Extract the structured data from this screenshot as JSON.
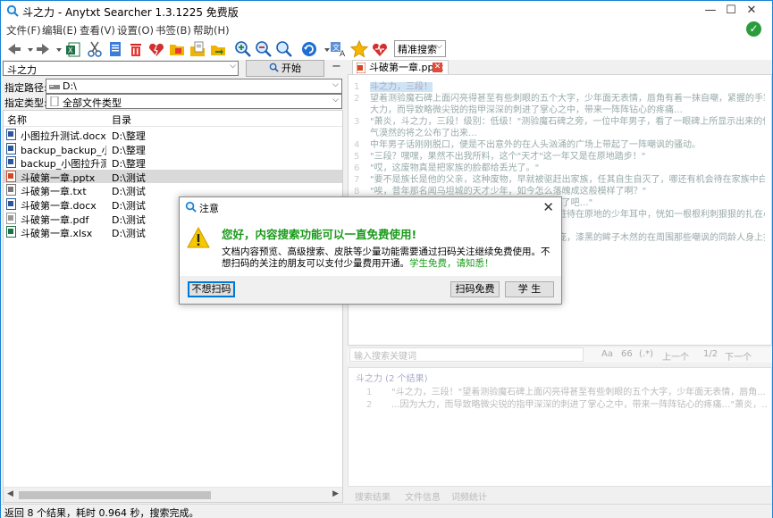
{
  "window": {
    "title": "斗之力 - Anytxt Searcher 1.3.1225 免费版",
    "controls": {
      "minimize": "—",
      "maximize": "☐",
      "close": "✕"
    }
  },
  "menu": {
    "items": [
      "文件(F)",
      "编辑(E)",
      "查看(V)",
      "设置(O)",
      "书签(B)",
      "帮助(H)"
    ]
  },
  "toolbar": {
    "search_mode": "精准搜索",
    "icons": [
      "back-arrow-icon",
      "back-dropdown-icon",
      "forward-arrow-icon",
      "forward-dropdown-icon",
      "excel-export-icon",
      "scissors-icon",
      "copy-doc-icon",
      "trash-icon",
      "broken-heart-icon",
      "open-folder-icon",
      "doc-folder-icon",
      "folder-arrow-icon",
      "zoom-in-icon",
      "zoom-out-icon",
      "search-icon",
      "refresh-icon",
      "translate-icon",
      "star-icon",
      "heart-icon"
    ]
  },
  "search": {
    "query": "斗之力",
    "start_label": "开始",
    "minus_label": "−"
  },
  "filters": {
    "path_label": "指定路径:",
    "path_value": "D:\\",
    "type_label": "指定类型:",
    "type_value": "全部文件类型"
  },
  "filelist": {
    "col_name": "名称",
    "col_dir": "目录",
    "rows": [
      {
        "name": "小图拉升测试.docx",
        "dir": "D:\\整理",
        "type": "word"
      },
      {
        "name": "backup_backup_小...",
        "dir": "D:\\整理",
        "type": "word"
      },
      {
        "name": "backup_小图拉升测...",
        "dir": "D:\\整理",
        "type": "word"
      },
      {
        "name": "斗破第一章.pptx",
        "dir": "D:\\测试",
        "type": "ppt",
        "selected": true
      },
      {
        "name": "斗破第一章.txt",
        "dir": "D:\\测试",
        "type": "txt"
      },
      {
        "name": "斗破第一章.docx",
        "dir": "D:\\测试",
        "type": "word"
      },
      {
        "name": "斗破第一章.pdf",
        "dir": "D:\\测试",
        "type": "pdf"
      },
      {
        "name": "斗破第一章.xlsx",
        "dir": "D:\\测试",
        "type": "excel"
      }
    ]
  },
  "preview": {
    "tab_label": "斗破第一章.pptx",
    "lines": [
      {
        "n": "1",
        "t": "斗之力，三段！"
      },
      {
        "n": "2",
        "t": "望着测验魔石碑上面闪亮得甚至有些刺眼的五个大字，少年面无表情，唇角有着一抹自嘲，紧握的手掌，因为"
      },
      {
        "n": "",
        "t": "大力，而导致略微尖锐的指甲深深的刺进了掌心之中，带来一阵阵钻心的疼痛…"
      },
      {
        "n": "3",
        "t": "\"萧炎，斗之力，三段！级别：低级！\"测验魔石碑之旁，一位中年男子，看了一眼碑上所显示出来的信息，语"
      },
      {
        "n": "",
        "t": "气漠然的将之公布了出来…"
      },
      {
        "n": "4",
        "t": "中年男子话刚刚脱口，便是不出意外的在人头汹涌的广场上带起了一阵嘲讽的骚动。"
      },
      {
        "n": "5",
        "t": "\"三段？嘿嘿，果然不出我所料，这个\"天才\"这一年又是在原地踏步！\""
      },
      {
        "n": "6",
        "t": "\"哎，这废物真是把家族的脸都给丢光了。\""
      },
      {
        "n": "7",
        "t": "\"要不是族长是他的父亲，这种废物，早就被驱赶出家族，任其自生自灭了，哪还有机会待在家族中白吃白喝。\""
      },
      {
        "n": "8",
        "t": "\"唉，昔年那名闻乌坦城的天才少年，如今怎么落魄成这般模样了啊？\""
      },
      {
        "n": "9",
        "t": "\"谁知道呢，或许做了什么亏心事，惹得神灵降怒了吧…\""
      },
      {
        "n": "10",
        "t": "周围传来的不屑嘲笑以及惋惜轻叹，落在那如木桩待在原地的少年耳中，恍如一根根利刺狠狠的扎在心脏一"
      },
      {
        "n": "",
        "t": "般，让得少年呼吸微微急促。"
      },
      {
        "n": "11",
        "t": "少年缓缓抬起头来，露出一张有些清秀的稚嫩脸庞，漆黑的眸子木然的在周围那些嘲讽的同龄人身上扫过，少"
      }
    ],
    "find_placeholder": "输入搜索关键词",
    "find_opts": [
      "Aa",
      "66",
      "(.*)",
      "上一个",
      "1/2",
      "下一个"
    ]
  },
  "results": {
    "header": "斗之力 (2 个结果)",
    "rows": [
      {
        "n": "1",
        "t": "\"斗之力，三段！\"望着测验魔石碑上面闪亮得甚至有些刺眼的五个大字，少年面无表情，唇角..."
      },
      {
        "n": "2",
        "t": "...因为大力，而导致略微尖锐的指甲深深的刺进了掌心之中，带来一阵阵钻心的疼痛…\"萧炎，..."
      }
    ],
    "tabs": [
      "搜索结果",
      "文件信息",
      "词频统计"
    ]
  },
  "status": {
    "text": "返回 8 个结果，耗时 0.964 秒，搜索完成。"
  },
  "dialog": {
    "title": "注意",
    "headline": "您好，内容搜索功能可以一直免费使用!",
    "body": "文档内容预览、高级搜索、皮肤等少量功能需要通过扫码关注继续免费使用。不想扫码的关注的朋友可以支付少量费用开通。",
    "body_green": "学生免费，请知悉！",
    "btn_no_scan": "不想扫码",
    "btn_scan_free": "扫码免费",
    "btn_student": "学 生",
    "colors": {
      "headline": "#1a9a1a",
      "accent": "#0078d7"
    }
  }
}
